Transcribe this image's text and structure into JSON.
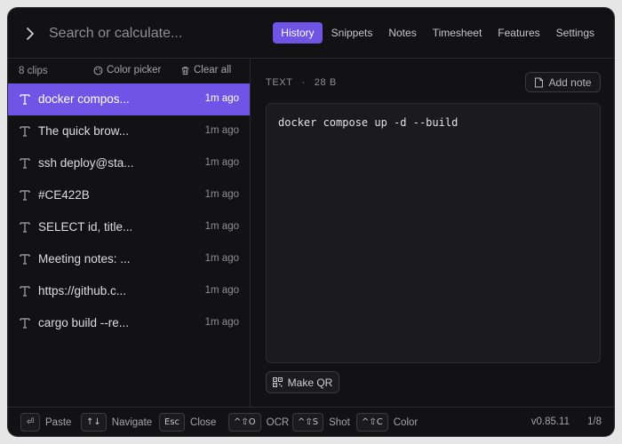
{
  "search": {
    "placeholder": "Search or calculate..."
  },
  "tabs": [
    {
      "label": "History",
      "active": true
    },
    {
      "label": "Snippets"
    },
    {
      "label": "Notes"
    },
    {
      "label": "Timesheet"
    },
    {
      "label": "Features"
    },
    {
      "label": "Settings"
    }
  ],
  "list": {
    "count": "8 clips",
    "color_picker": "Color picker",
    "clear_all": "Clear all",
    "items": [
      {
        "text": "docker compos...",
        "ago": "1m ago",
        "selected": true
      },
      {
        "text": "The quick brow...",
        "ago": "1m ago"
      },
      {
        "text": "ssh deploy@sta...",
        "ago": "1m ago"
      },
      {
        "text": "#CE422B",
        "ago": "1m ago"
      },
      {
        "text": "SELECT id, title...",
        "ago": "1m ago"
      },
      {
        "text": "Meeting notes: ...",
        "ago": "1m ago"
      },
      {
        "text": "https://github.c...",
        "ago": "1m ago"
      },
      {
        "text": "cargo build --re...",
        "ago": "1m ago"
      }
    ]
  },
  "detail": {
    "type": "TEXT",
    "separator": "·",
    "size": "28 B",
    "add_note": "Add note",
    "content": "docker compose up -d --build",
    "make_qr": "Make QR"
  },
  "footer": {
    "shortcuts": [
      {
        "key": "⏎",
        "label": "Paste"
      },
      {
        "key": "↑↓",
        "label": "Navigate"
      },
      {
        "key": "Esc",
        "label": "Close"
      },
      {
        "key": "^⇧O",
        "label": "OCR"
      },
      {
        "key": "^⇧S",
        "label": "Shot"
      },
      {
        "key": "^⇧C",
        "label": "Color"
      }
    ],
    "version": "v0.85.11",
    "position": "1/8"
  },
  "colors": {
    "accent": "#6e55e6",
    "background": "#121214"
  }
}
